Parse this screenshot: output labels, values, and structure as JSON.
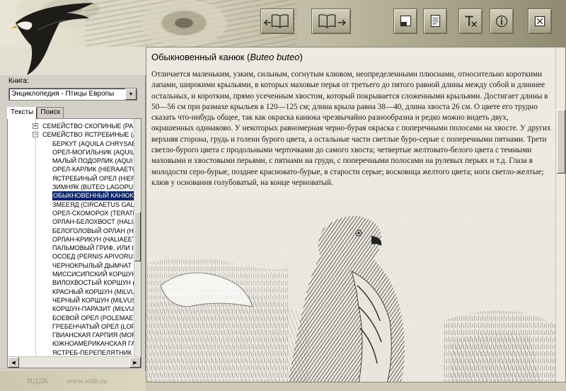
{
  "toolbar": {
    "back_icon": "book-back-icon",
    "forward_icon": "book-forward-icon",
    "minimize_icon": "minimize-window-icon",
    "notes_icon": "notes-icon",
    "tools_icon": "text-tools-icon",
    "info_icon": "info-icon",
    "close_icon": "close-icon"
  },
  "sidebar": {
    "book_label": "Книга:",
    "book_value": "Энциклопедия - Птицы Европы",
    "tabs": [
      {
        "label": "Тексты"
      },
      {
        "label": "Поиск"
      }
    ],
    "tree": [
      {
        "label": "СЕМЕЙСТВО СКОПИНЫЕ  (PA",
        "group": true,
        "expander": "+"
      },
      {
        "label": "СЕМЕЙСТВО ЯСТРЕБИНЫЕ  (A",
        "group": true,
        "expander": "−"
      },
      {
        "label": "БЕРКУТ (AQUILA CHRYSAE"
      },
      {
        "label": "ОРЕЛ-МОГИЛЬНИК (AQUIL"
      },
      {
        "label": "МАЛЫЙ ПОДОРЛИК (AQUI"
      },
      {
        "label": "ОРЕЛ-КАРЛИК (HIERAAETU"
      },
      {
        "label": "ЯСТРЕБИНЫЙ ОРЕЛ (HIERA"
      },
      {
        "label": "ЗИМНЯК (BUTEO LAGOPUS"
      },
      {
        "label": "ОБЫКНОВЕННЫЙ КАНЮК (",
        "selected": true
      },
      {
        "label": "ЗМЕЕЯД (CIRCAETUS GALL"
      },
      {
        "label": "ОРЕЛ-СКОМОРОХ (TERATH"
      },
      {
        "label": "ОРЛАН-БЕЛОХВОСТ (HALIA"
      },
      {
        "label": "БЕЛОГОЛОВЫЙ ОРЛАН (HA"
      },
      {
        "label": "ОРЛАН-КРИКУН (HALIAEET"
      },
      {
        "label": "ПАЛЬМОВЫЙ ГРИФ, ИЛИ I"
      },
      {
        "label": "ОСОЕД (PERNIS APIVORUS"
      },
      {
        "label": "ЧЕРНОКРЫЛЫЙ ДЫМЧАТ"
      },
      {
        "label": "МИССИСИПСКИЙ КОРШУН"
      },
      {
        "label": "ВИЛОХВОСТЫЙ КОРШУН ("
      },
      {
        "label": "КРАСНЫЙ КОРШУН (MILVU"
      },
      {
        "label": "ЧЕРНЫЙ КОРШУН (MILVUS"
      },
      {
        "label": "КОРШУН-ПАРАЗИТ (MILVUS"
      },
      {
        "label": "БОЕВОЙ ОРЕЛ (POLEMAET"
      },
      {
        "label": "ГРЕБЕНЧАТЫЙ ОРЕЛ (LOP"
      },
      {
        "label": "ГВИАНСКАЯ ГАРПИЯ (MOR"
      },
      {
        "label": "ЮЖНОАМЕРИКАНСКАЯ ГА"
      },
      {
        "label": "ЯСТРЕБ-ПЕРЕПЕЛЯТНИК ("
      }
    ]
  },
  "footer": {
    "left": "ИДДК",
    "right": "www.iddk.ru"
  },
  "article": {
    "title_ru": "Обыкновенный канюк",
    "title_latin_open": "(",
    "title_latin": "Buteo buteo",
    "title_latin_close": ")",
    "body": "Отличается маленьким, узким, сильным, согнутым клювом, неопределенными плюснами, относительно короткими лапами, широкими крыльями, в которых маховые перья от третьего до пятого равной длины между собой и длиннее остальных, и коротким, прямо усеченным хвостом, который покрывается сложенными крыльями. Достигает длины в 50—56 см при размахе крыльев в 120—125 см; длина крыла равна 38—40, длина хвоста 26 см. О цвете его трудно сказать что-нибудь общее, так как окраска канюка чрезвычайно разнообразна и редко можно видеть двух, окрашенных одинаково. У некоторых равномерная черно-бурая окраска с поперечными полосами на хвосте. У других верхняя сторона, грудь и голени бурого цвета, а остальные части светлые буро-серые с поперечными пятнами. Трети светло-бурого цвета с продольными черточками до самого хвоста; четвертые желтовато-белого цвета с темными маховыми и хвостовыми перьями, с пятнами на груди, с поперечными полосами на рулевых перьях и т.д. Глаза в молодости серо-бурые, позднее красновато-бурые, в старости серые; восковица желтого цвета; ноги светло-желтые; клюв у основания голубоватый, на конце черноватый."
  },
  "colors": {
    "selection": "#0a246a",
    "panel": "#d4d0c8",
    "paper": "#eeebe2"
  }
}
